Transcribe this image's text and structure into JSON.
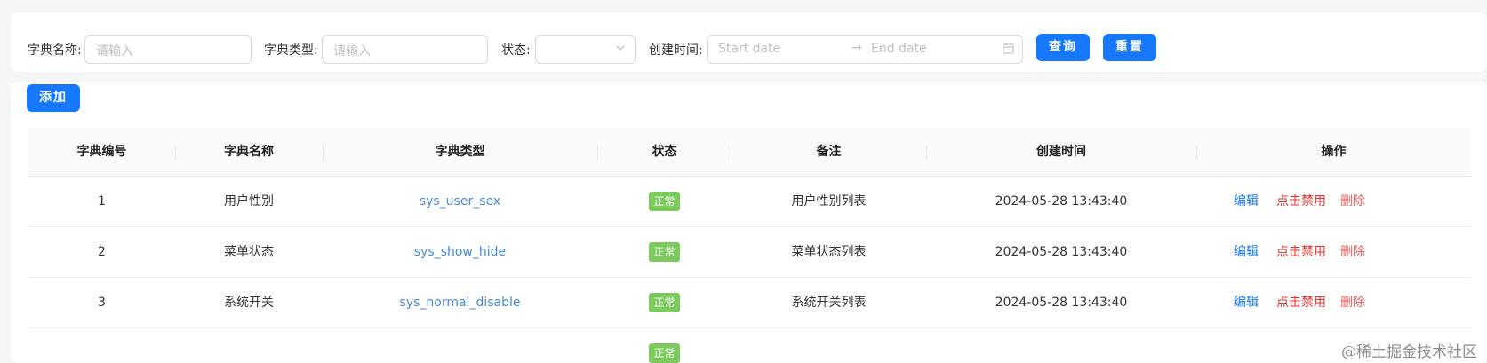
{
  "filters": {
    "dict_name_label": "字典名称:",
    "dict_name_placeholder": "请输入",
    "dict_type_label": "字典类型:",
    "dict_type_placeholder": "请输入",
    "status_label": "状态:",
    "status_value": "",
    "created_label": "创建时间:",
    "start_placeholder": "Start date",
    "end_placeholder": "End date",
    "range_separator": "→",
    "query_label": "查询",
    "reset_label": "重置"
  },
  "toolbar": {
    "add_label": "添加"
  },
  "table": {
    "columns": [
      "字典编号",
      "字典名称",
      "字典类型",
      "状态",
      "备注",
      "创建时间",
      "操作"
    ],
    "rows": [
      {
        "id": "1",
        "name": "用户性别",
        "type": "sys_user_sex",
        "status": "正常",
        "remark": "用户性别列表",
        "created": "2024-05-28 13:43:40",
        "edit": "编辑",
        "disable": "点击禁用",
        "delete": "删除"
      },
      {
        "id": "2",
        "name": "菜单状态",
        "type": "sys_show_hide",
        "status": "正常",
        "remark": "菜单状态列表",
        "created": "2024-05-28 13:43:40",
        "edit": "编辑",
        "disable": "点击禁用",
        "delete": "删除"
      },
      {
        "id": "3",
        "name": "系统开关",
        "type": "sys_normal_disable",
        "status": "正常",
        "remark": "系统开关列表",
        "created": "2024-05-28 13:43:40",
        "edit": "编辑",
        "disable": "点击禁用",
        "delete": "删除"
      }
    ],
    "partial_row_status": "正常"
  },
  "watermark": "@稀土掘金技术社区",
  "colors": {
    "primary": "#1677ff",
    "status_normal": "#7cc95e",
    "danger": "#e0362f",
    "link": "#4a8ad6"
  },
  "icons": {
    "select_arrow": "chevron-down-icon",
    "date_picker": "calendar-icon"
  }
}
